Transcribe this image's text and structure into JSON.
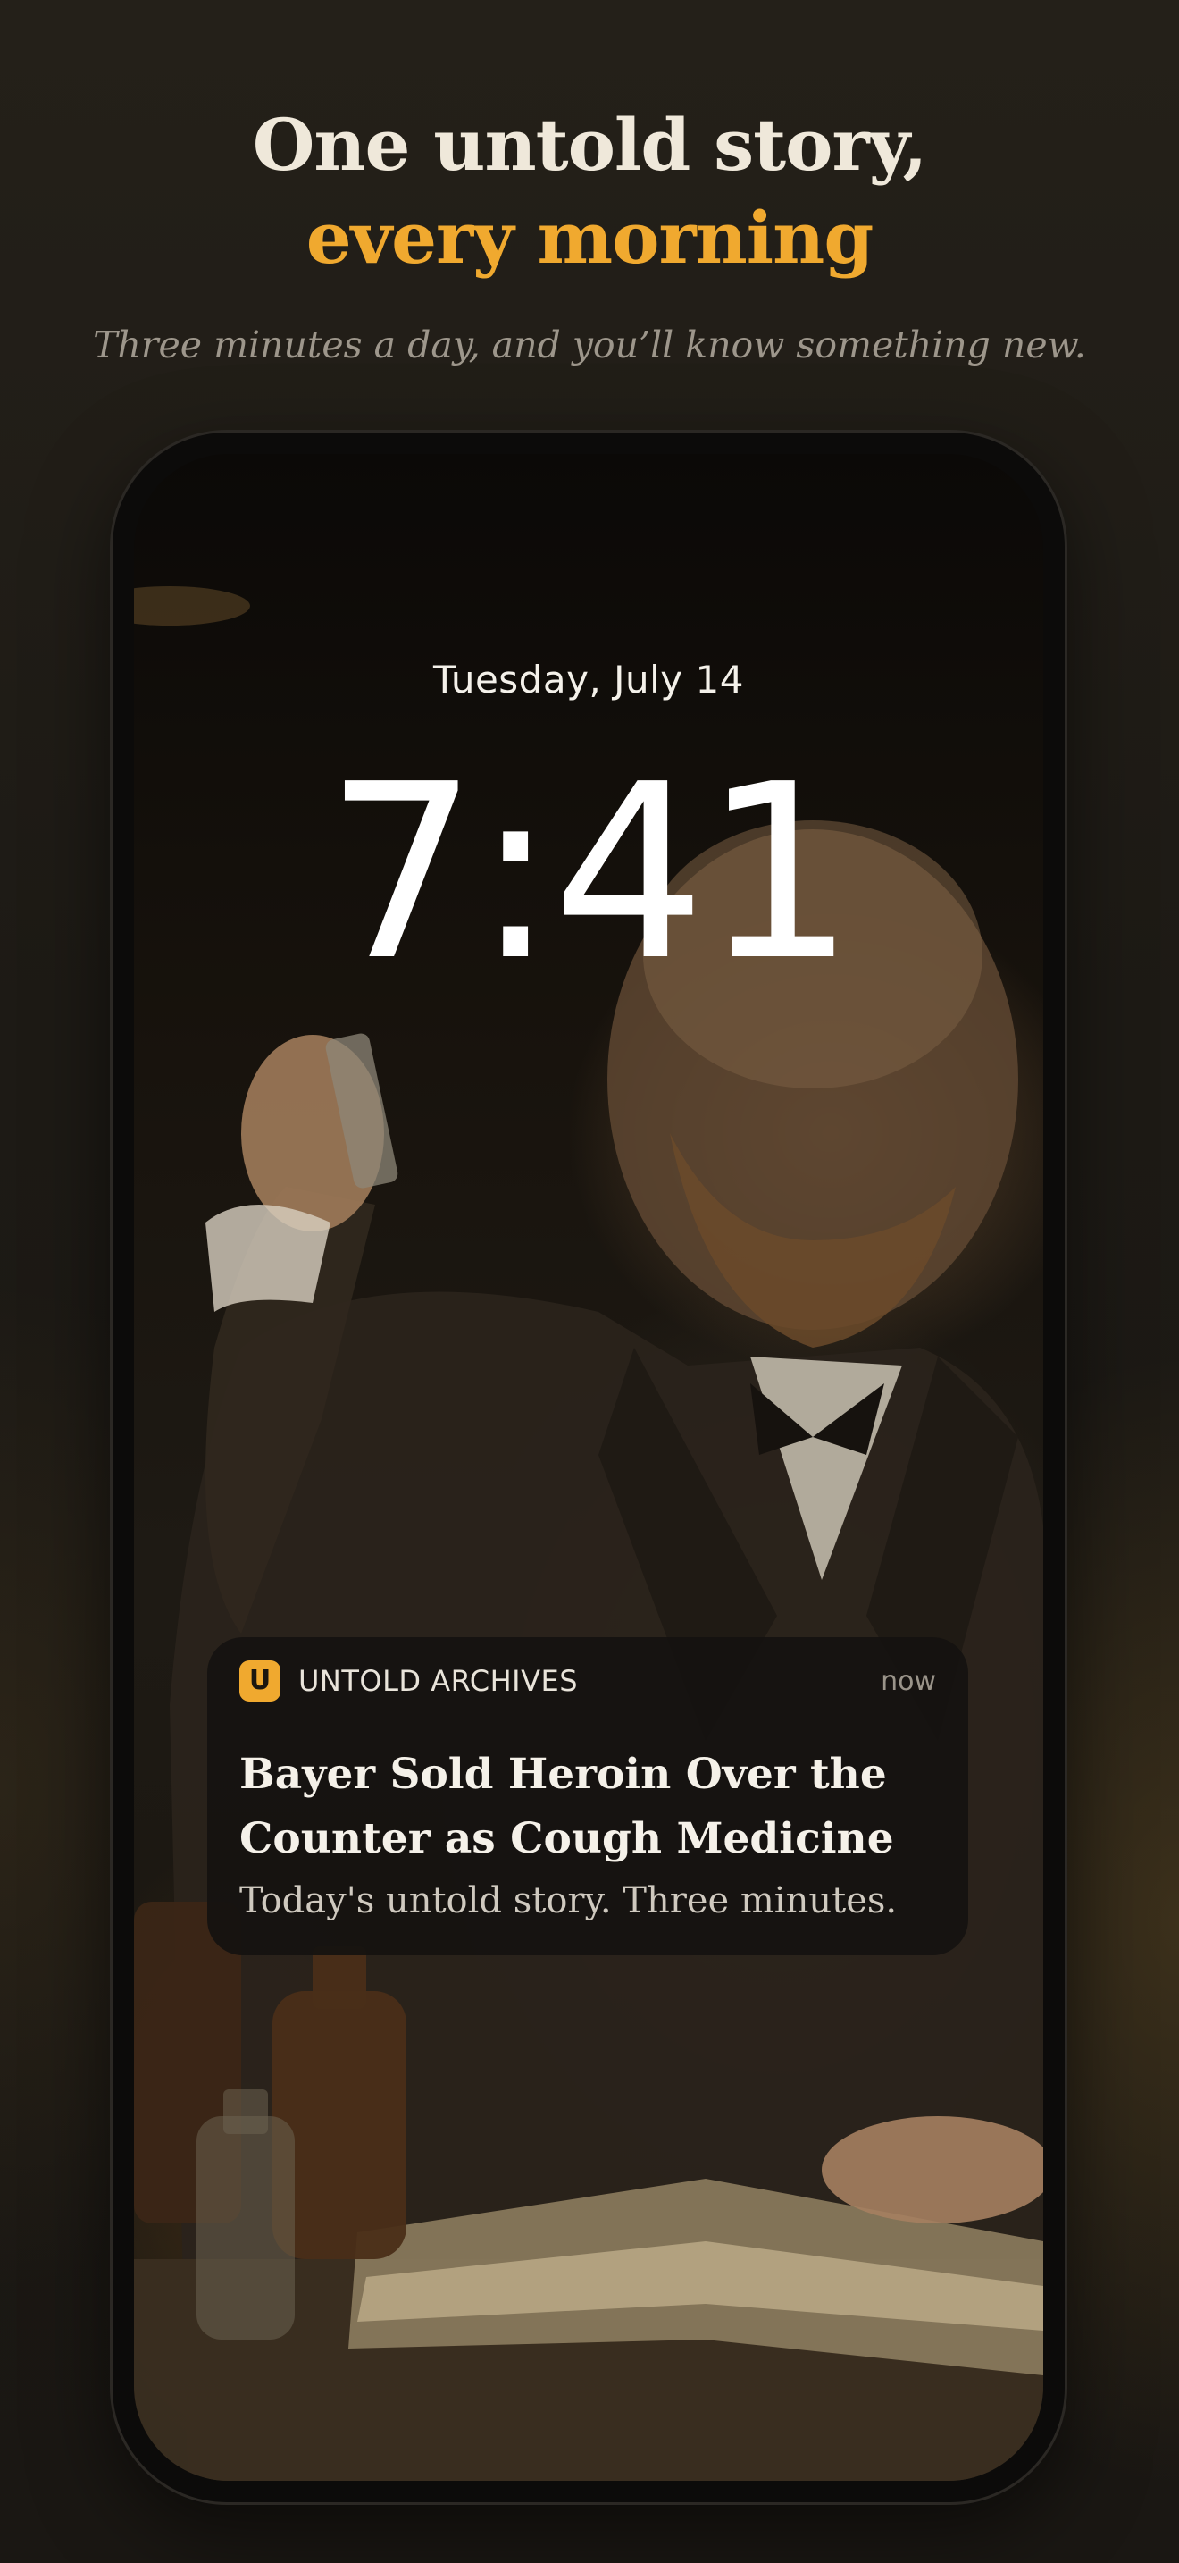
{
  "headline": {
    "line1": "One untold story,",
    "line2": "every morning"
  },
  "tagline": "Three minutes a day, and you’ll know something new.",
  "lockscreen": {
    "date": "Tuesday, July 14",
    "time": "7:41"
  },
  "notification": {
    "app_icon_letter": "U",
    "app_name": "UNTOLD ARCHIVES",
    "time": "now",
    "title": "Bayer Sold Heroin Over the Counter as Cough Medicine",
    "body": "Today's untold story. Three minutes."
  },
  "colors": {
    "accent": "#f0a92f",
    "background": "#1f1c17",
    "headline": "#efe8da"
  },
  "icons": {
    "app_icon": "untold-archives-logo-icon"
  }
}
